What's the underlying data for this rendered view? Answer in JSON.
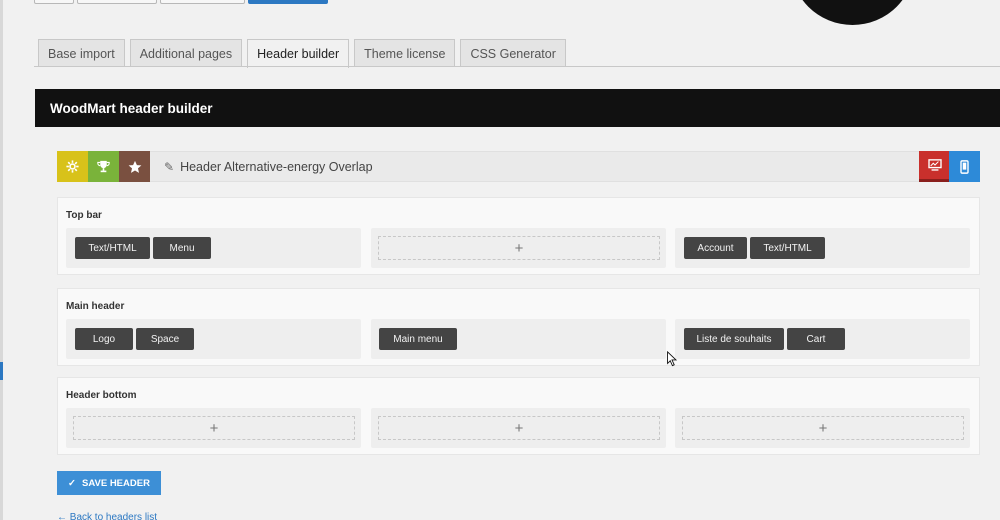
{
  "tabs": [
    {
      "label": "Base import"
    },
    {
      "label": "Additional pages"
    },
    {
      "label": "Header builder",
      "active": true
    },
    {
      "label": "Theme license"
    },
    {
      "label": "CSS Generator"
    }
  ],
  "panel": {
    "title": "WoodMart header builder"
  },
  "toolbar": {
    "icons": [
      "gear-icon",
      "trophy-icon",
      "star-icon"
    ],
    "header_name": "Header Alternative-energy Overlap",
    "view_icons": [
      "desktop-icon",
      "mobile-icon"
    ]
  },
  "rows": [
    {
      "label": "Top bar",
      "left": [
        "Text/HTML",
        "Menu"
      ],
      "center": [],
      "right": [
        "Account",
        "Text/HTML"
      ]
    },
    {
      "label": "Main header",
      "left": [
        "Logo",
        "Space"
      ],
      "center": [
        "Main menu"
      ],
      "right": [
        "Liste de souhaits",
        "Cart"
      ]
    },
    {
      "label": "Header bottom",
      "left": [],
      "center": [],
      "right": []
    }
  ],
  "add_symbol": "+",
  "save": {
    "label": "SAVE HEADER",
    "check": "✓"
  },
  "back_link": "← Back to headers list",
  "colors": {
    "panel_bg": "#111111",
    "save_button": "#3d8fd6",
    "icon_yellow": "#d8c21a",
    "icon_green": "#7ab33a",
    "icon_brown": "#7a5040",
    "desktop_red": "#c9302c",
    "mobile_blue": "#2d8ad8"
  }
}
